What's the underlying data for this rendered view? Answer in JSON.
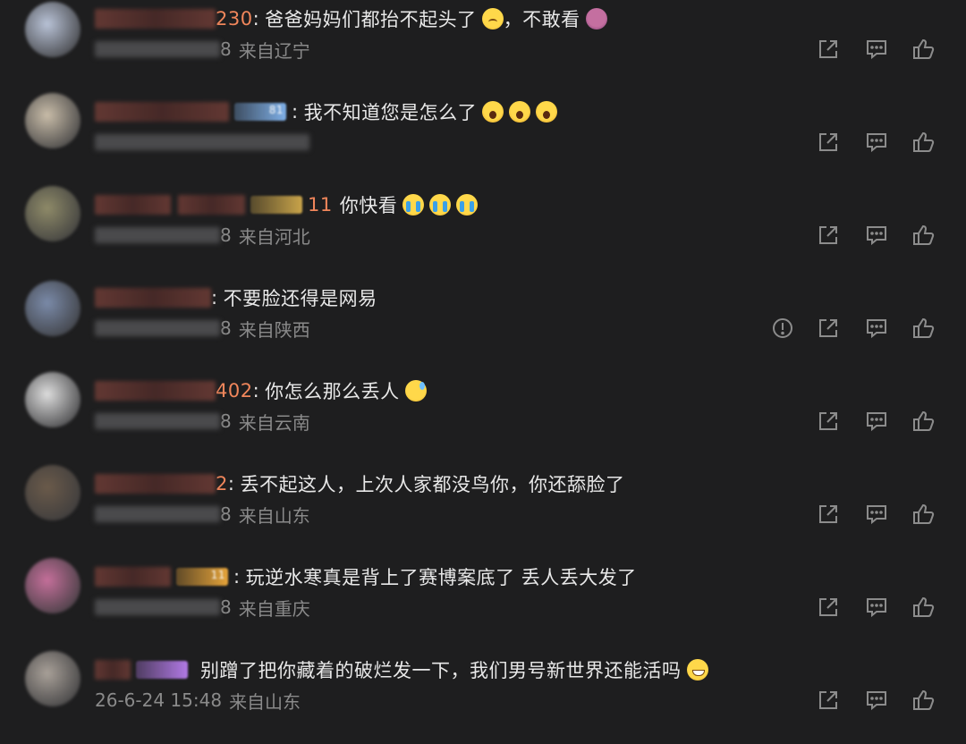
{
  "comments": [
    {
      "name_tail": "230",
      "sep": ":",
      "text": "爸爸妈妈们都抬不起头了",
      "emojis": [
        "sad"
      ],
      "text2": "，不敢看",
      "emojis2": [
        "cover"
      ],
      "time_tail": "8",
      "location": "来自辽宁",
      "report": false,
      "avatar_color": "#b8c2d6",
      "name_color": "#6a3b35",
      "badge": null
    },
    {
      "name_tail": "",
      "sep": ":",
      "text": "我不知道您是怎么了",
      "emojis": [
        "fear",
        "fear",
        "fear"
      ],
      "text2": "",
      "emojis2": [],
      "time_tail": "",
      "location": "",
      "report": false,
      "avatar_color": "#c8bca8",
      "name_color": "#6a3b35",
      "badge": {
        "color": "#7fb0e8",
        "level": "81"
      }
    },
    {
      "name_tail": "11",
      "sep": "",
      "text": "你快看",
      "emojis": [
        "cry",
        "cry",
        "cry"
      ],
      "text2": "",
      "emojis2": [],
      "time_tail": "8",
      "location": "来自河北",
      "report": false,
      "avatar_color": "#8e8a68",
      "name_color": "#6a3b35",
      "badge": {
        "color": "#c9a44a",
        "level": ""
      }
    },
    {
      "name_tail": "",
      "sep": ":",
      "text": "不要脸还得是网易",
      "emojis": [],
      "text2": "",
      "emojis2": [],
      "time_tail": "8",
      "location": "来自陕西",
      "report": true,
      "avatar_color": "#7a8aa8",
      "name_color": "#6a3b35",
      "badge": null
    },
    {
      "name_tail": "402",
      "sep": ":",
      "text": "你怎么那么丢人",
      "emojis": [
        "sweat"
      ],
      "text2": "",
      "emojis2": [],
      "time_tail": "8",
      "location": "来自云南",
      "report": false,
      "avatar_color": "#dcdcdc",
      "name_color": "#6a3b35",
      "badge": null
    },
    {
      "name_tail": "2",
      "sep": ":",
      "text": "丢不起这人，上次人家都没鸟你，你还舔脸了",
      "emojis": [],
      "text2": "",
      "emojis2": [],
      "time_tail": "8",
      "location": "来自山东",
      "report": false,
      "avatar_color": "#6a5a4a",
      "name_color": "#6a3b35",
      "badge": null
    },
    {
      "name_tail": "",
      "sep": ":",
      "text": "玩逆水寒真是背上了赛博案底了 丢人丢大发了",
      "emojis": [],
      "text2": "",
      "emojis2": [],
      "time_tail": "8",
      "location": "来自重庆",
      "report": false,
      "avatar_color": "#c46f9a",
      "name_color": "#6a3b35",
      "badge": {
        "color": "#e6a43a",
        "level": "11"
      }
    },
    {
      "name_tail": "",
      "sep": "",
      "text": "别蹭了把你藏着的破烂发一下，我们男号新世界还能活吗",
      "emojis": [
        "grin"
      ],
      "text2": "",
      "emojis2": [],
      "time_tail": "26-6-24 15:48",
      "location": "来自山东",
      "report": false,
      "avatar_color": "#a8a098",
      "name_color": "#6a3b35",
      "badge": {
        "color": "#b27ae6",
        "level": ""
      }
    }
  ],
  "colors": {
    "background": "#1e1e1f",
    "name_accent": "#f0865b",
    "meta": "#8a8a8a",
    "icon": "#8c8c8c"
  }
}
